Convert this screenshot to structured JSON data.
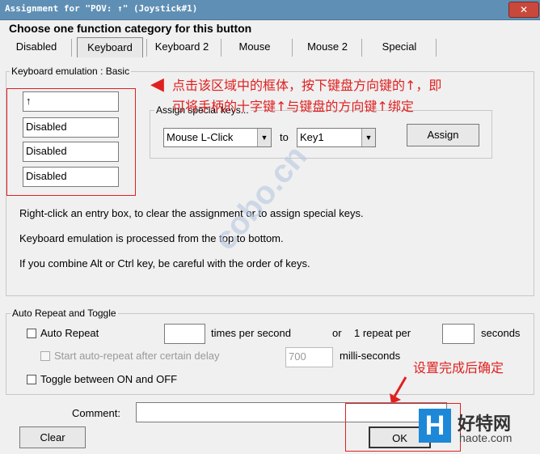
{
  "window": {
    "title": "Assignment for \"POV: ↑\" (Joystick#1)",
    "close_glyph": "✕"
  },
  "heading": "Choose one function category for this button",
  "tabs": [
    {
      "label": "Disabled"
    },
    {
      "label": "Keyboard",
      "active": true
    },
    {
      "label": "Keyboard 2"
    },
    {
      "label": "Mouse"
    },
    {
      "label": "Mouse 2"
    },
    {
      "label": "Special"
    }
  ],
  "keyboard_group": {
    "label": "Keyboard emulation : Basic",
    "entries": [
      "↑",
      "Disabled",
      "Disabled",
      "Disabled"
    ],
    "special": {
      "label": "Assign special keys...",
      "mouse_select": "Mouse L-Click",
      "to_label": "to",
      "key_select": "Key1",
      "assign_label": "Assign"
    },
    "info": [
      "Right-click an entry box, to clear the assignment or to assign special keys.",
      "Keyboard emulation is processed from the top to bottom.",
      "If you combine Alt or Ctrl key, be careful with the order of keys."
    ]
  },
  "annotation": {
    "line1": "点击该区域中的框体，按下键盘方向键的↑，即",
    "line2": "可将手柄的十字键↑与键盘的方向键↑绑定",
    "ok_hint": "设置完成后确定"
  },
  "repeat_group": {
    "label": "Auto Repeat and Toggle",
    "auto_repeat_label": "Auto Repeat",
    "times_value": "",
    "times_label": "times per second",
    "or_label": "or",
    "one_repeat_label": "1 repeat per",
    "seconds_value": "",
    "seconds_label": "seconds",
    "delay_label": "Start auto-repeat after certain delay",
    "delay_value": "700",
    "delay_unit": "milli-seconds",
    "toggle_label": "Toggle between ON and OFF"
  },
  "footer": {
    "comment_label": "Comment:",
    "comment_value": "",
    "clear_label": "Clear",
    "ok_label": "OK"
  },
  "watermark": {
    "logo_letter": "H",
    "site_name": "好特网",
    "site_url": "haote.com"
  },
  "colors": {
    "titlebar": "#5f8fb4",
    "annotation": "#e02020",
    "logo": "#1e88d8"
  }
}
